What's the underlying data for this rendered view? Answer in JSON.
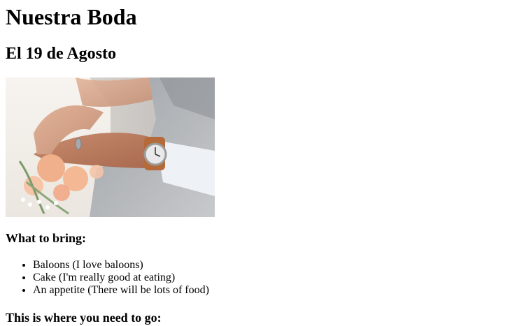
{
  "page": {
    "title": "Nuestra Boda",
    "date": "El 19 de Agosto",
    "photo_alt": "wedding hands with bouquet and watch"
  },
  "bring": {
    "heading": "What to bring:",
    "items": [
      {
        "label": "Baloons (I love baloons)"
      },
      {
        "label": "Cake (I'm really good at eating)"
      },
      {
        "label": "An appetite (There will be lots of food)"
      }
    ]
  },
  "location": {
    "heading": "This is where you need to go:"
  }
}
